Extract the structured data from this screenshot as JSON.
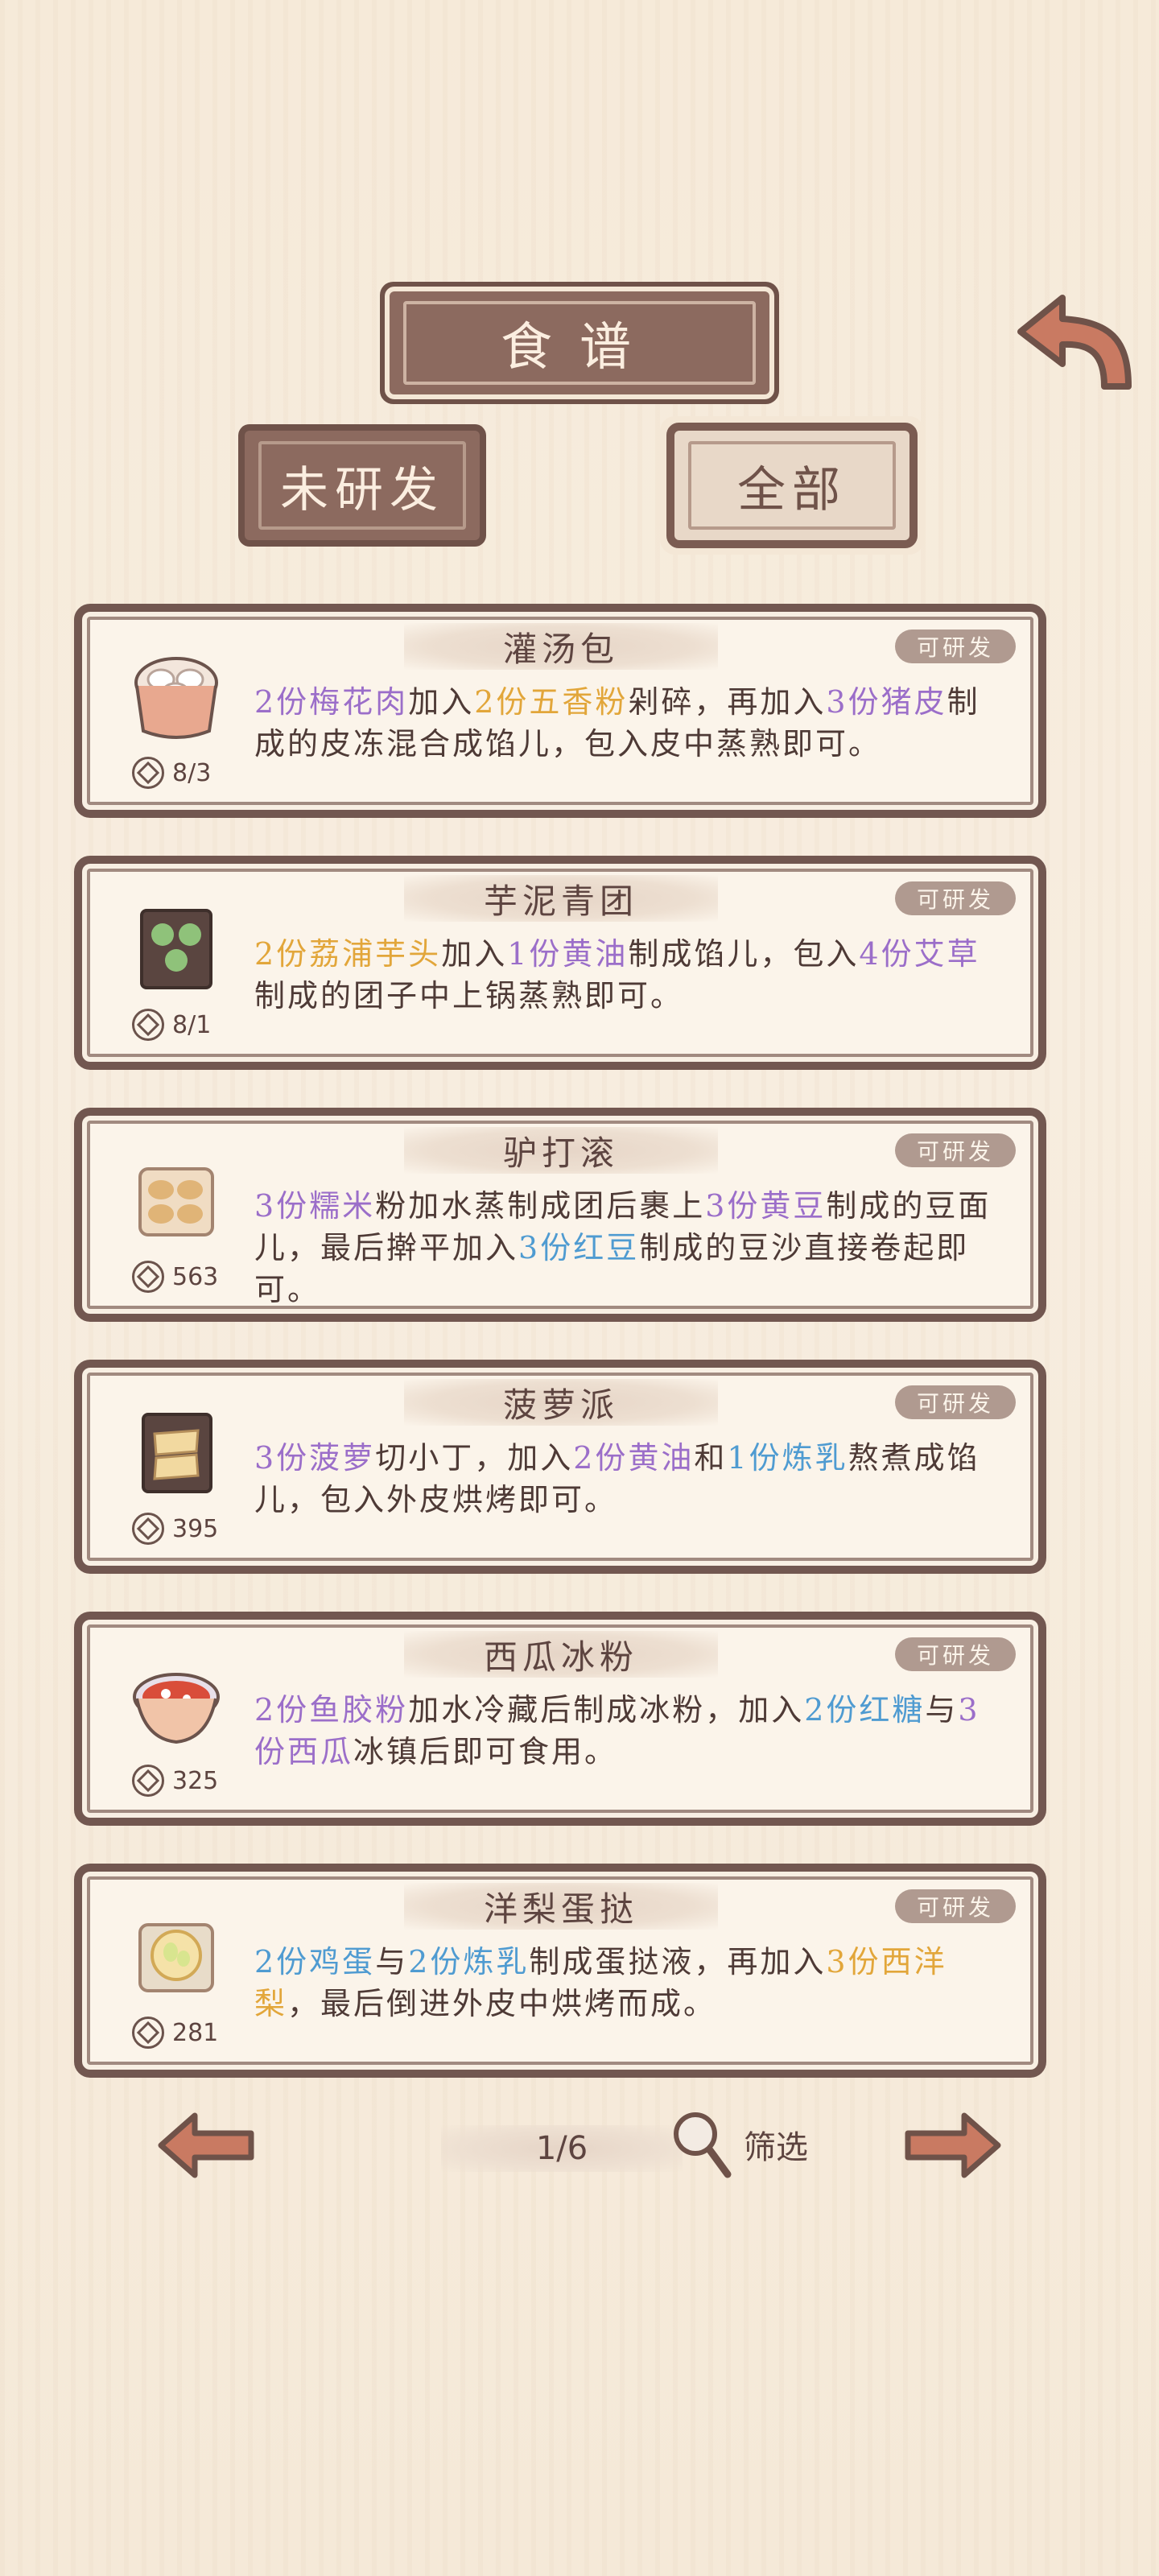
{
  "header": {
    "title": "食谱"
  },
  "tabs": {
    "left": "未研发",
    "right": "全部"
  },
  "recipes": [
    {
      "name": "灌汤包",
      "badge": "可研发",
      "price": "8/3",
      "icon": "steamed-bun-basket-icon",
      "desc": [
        {
          "t": "2份梅花肉",
          "c": "p"
        },
        {
          "t": "加入",
          "c": ""
        },
        {
          "t": "2份五香粉",
          "c": "o"
        },
        {
          "t": "剁碎，再加入",
          "c": ""
        },
        {
          "t": "3份猪皮",
          "c": "p"
        },
        {
          "t": "制成的皮冻混合成馅儿，包入皮中蒸熟即可。",
          "c": ""
        }
      ]
    },
    {
      "name": "芋泥青团",
      "badge": "可研发",
      "price": "8/1",
      "icon": "green-rice-ball-plate-icon",
      "desc": [
        {
          "t": "2份荔浦芋头",
          "c": "o"
        },
        {
          "t": "加入",
          "c": ""
        },
        {
          "t": "1份黄油",
          "c": "p"
        },
        {
          "t": "制成馅儿，包入",
          "c": ""
        },
        {
          "t": "4份艾草",
          "c": "p"
        },
        {
          "t": "制成的团子中上锅蒸熟即可。",
          "c": ""
        }
      ]
    },
    {
      "name": "驴打滚",
      "badge": "可研发",
      "price": "563",
      "icon": "rolled-bean-cake-icon",
      "desc": [
        {
          "t": "3份糯米",
          "c": "p"
        },
        {
          "t": "粉加水蒸制成团后裹上",
          "c": ""
        },
        {
          "t": "3份黄豆",
          "c": "p"
        },
        {
          "t": "制成的豆面儿，最后擀平加入",
          "c": ""
        },
        {
          "t": "3份红豆",
          "c": "b"
        },
        {
          "t": "制成的豆沙直接卷起即可。",
          "c": ""
        }
      ]
    },
    {
      "name": "菠萝派",
      "badge": "可研发",
      "price": "395",
      "icon": "pineapple-pie-plate-icon",
      "desc": [
        {
          "t": "3份菠萝",
          "c": "p"
        },
        {
          "t": "切小丁，加入",
          "c": ""
        },
        {
          "t": "2份黄油",
          "c": "p"
        },
        {
          "t": "和",
          "c": ""
        },
        {
          "t": "1份炼乳",
          "c": "b"
        },
        {
          "t": "熬煮成馅儿，包入外皮烘烤即可。",
          "c": ""
        }
      ]
    },
    {
      "name": "西瓜冰粉",
      "badge": "可研发",
      "price": "325",
      "icon": "watermelon-jelly-bowl-icon",
      "desc": [
        {
          "t": "2份鱼胶粉",
          "c": "p"
        },
        {
          "t": "加水冷藏后制成冰粉，加入",
          "c": ""
        },
        {
          "t": "2份红糖",
          "c": "b"
        },
        {
          "t": "与",
          "c": ""
        },
        {
          "t": "3份西瓜",
          "c": "p"
        },
        {
          "t": "冰镇后即可食用。",
          "c": ""
        }
      ]
    },
    {
      "name": "洋梨蛋挞",
      "badge": "可研发",
      "price": "281",
      "icon": "pear-egg-tart-plate-icon",
      "desc": [
        {
          "t": "2份鸡蛋",
          "c": "b"
        },
        {
          "t": "与",
          "c": ""
        },
        {
          "t": "2份炼乳",
          "c": "b"
        },
        {
          "t": "制成蛋挞液，再加入",
          "c": ""
        },
        {
          "t": "3份西洋梨",
          "c": "o"
        },
        {
          "t": "，最后倒进外皮中烘烤而成。",
          "c": ""
        }
      ]
    }
  ],
  "pager": {
    "page": "1/6",
    "filter_label": "筛选"
  },
  "colors": {
    "purple": "#9b6ec9",
    "orange": "#e2a63a",
    "blue": "#4f9bd1",
    "frame": "#725750"
  }
}
